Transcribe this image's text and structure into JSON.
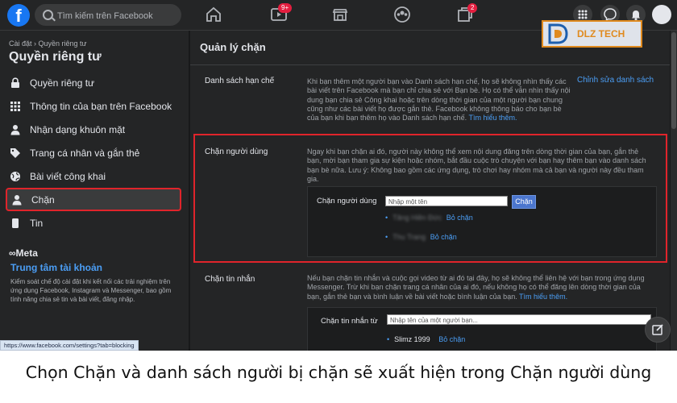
{
  "topbar": {
    "logo": "f",
    "search_placeholder": "Tìm kiếm trên Facebook",
    "video_badge": "9+",
    "gaming_badge": "2",
    "icons": [
      "home-icon",
      "video-icon",
      "marketplace-icon",
      "groups-icon",
      "gaming-icon",
      "menu-grid-icon",
      "messenger-icon",
      "bell-icon",
      "account-icon"
    ]
  },
  "watermark": {
    "text": "DLZ TECH"
  },
  "sidebar": {
    "breadcrumb": "Cài đặt › Quyền riêng tư",
    "title": "Quyền riêng tư",
    "items": [
      {
        "label": "Quyền riêng tư",
        "icon": "lock-icon"
      },
      {
        "label": "Thông tin của bạn trên Facebook",
        "icon": "grid-icon"
      },
      {
        "label": "Nhận dạng khuôn mặt",
        "icon": "person-icon"
      },
      {
        "label": "Trang cá nhân và gắn thẻ",
        "icon": "tag-icon"
      },
      {
        "label": "Bài viết công khai",
        "icon": "globe-icon"
      },
      {
        "label": "Chặn",
        "icon": "person-block-icon"
      },
      {
        "label": "Tin",
        "icon": "story-icon"
      }
    ],
    "meta": "∞Meta",
    "accounts_center": "Trung tâm tài khoản",
    "accounts_desc": "Kiểm soát chế độ cài đặt khi kết nối các trải nghiệm trên ứng dụng Facebook, Instagram và Messenger, bao gồm tính năng chia sẻ tin và bài viết, đăng nhập."
  },
  "status_url": "https://www.facebook.com/settings?tab=blocking",
  "main": {
    "title": "Quản lý chặn",
    "restricted": {
      "label": "Danh sách hạn chế",
      "text": "Khi bạn thêm một người bạn vào Danh sách hạn chế, họ sẽ không nhìn thấy các bài viết trên Facebook mà bạn chỉ chia sẻ với Bạn bè. Họ có thể vẫn nhìn thấy nội dung bạn chia sẻ Công khai hoặc trên dòng thời gian của một người bạn chung cũng như các bài viết họ được gắn thẻ. Facebook không thông báo cho bạn bè của bạn khi bạn thêm họ vào Danh sách hạn chế.",
      "learn_more": "Tìm hiểu thêm.",
      "edit_link": "Chỉnh sửa danh sách"
    },
    "block_users": {
      "label": "Chặn người dùng",
      "text": "Ngay khi bạn chặn ai đó, người này không thể xem nội dung đăng trên dòng thời gian của bạn, gắn thẻ bạn, mời bạn tham gia sự kiện hoặc nhóm, bắt đầu cuộc trò chuyện với bạn hay thêm bạn vào danh sách bạn bè nữa. Lưu ý: Không bao gồm các ứng dụng, trò chơi hay nhóm mà cả bạn và người này đều tham gia.",
      "field_label": "Chặn người dùng",
      "field_placeholder": "Nhập một tên",
      "button": "Chặn",
      "blocked": [
        {
          "name": "Tăng Hiền Đức",
          "action": "Bỏ chặn"
        },
        {
          "name": "Thu Trang",
          "action": "Bỏ chặn"
        }
      ]
    },
    "block_messages": {
      "label": "Chặn tin nhắn",
      "text": "Nếu bạn chặn tin nhắn và cuộc gọi video từ ai đó tại đây, họ sẽ không thể liên hệ với bạn trong ứng dụng Messenger. Trừ khi bạn chặn trang cá nhân của ai đó, nếu không họ có thể đăng lên dòng thời gian của bạn, gắn thẻ bạn và bình luận về bài viết hoặc bình luận của bạn.",
      "learn_more": "Tìm hiểu thêm.",
      "field_label": "Chặn tin nhắn từ",
      "field_placeholder": "Nhập tên của một người bạn...",
      "blocked": [
        {
          "name": "Slimz 1999",
          "action": "Bỏ chặn"
        }
      ]
    }
  },
  "caption": "Chọn Chặn và danh sách người bị chặn sẽ xuất hiện trong Chặn người dùng"
}
